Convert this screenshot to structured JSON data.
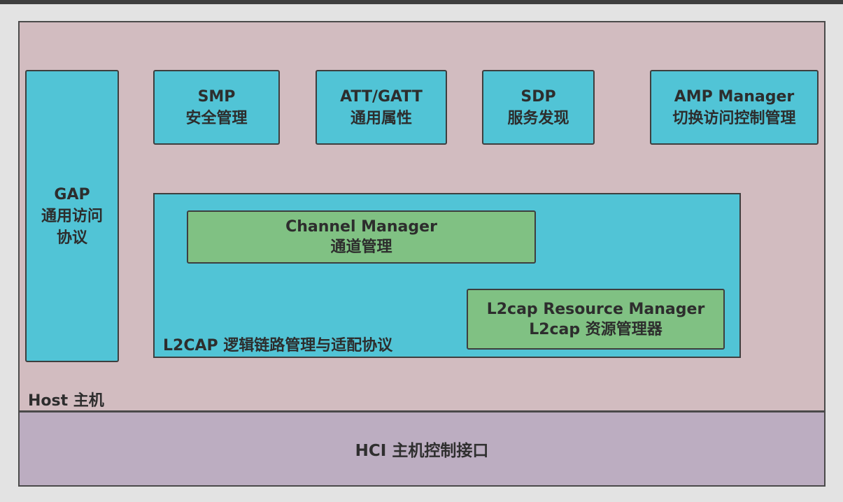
{
  "host": {
    "label": "Host 主机"
  },
  "hci": {
    "label": "HCI 主机控制接口"
  },
  "gap": {
    "line1": "GAP",
    "line2": "通用访问",
    "line3": "协议"
  },
  "smp": {
    "line1": "SMP",
    "line2": "安全管理"
  },
  "att": {
    "line1": "ATT/GATT",
    "line2": "通用属性"
  },
  "sdp": {
    "line1": "SDP",
    "line2": "服务发现"
  },
  "amp": {
    "line1": "AMP Manager",
    "line2": "切换访问控制管理"
  },
  "l2cap": {
    "label": "L2CAP 逻辑链路管理与适配协议",
    "channel": {
      "line1": "Channel Manager",
      "line2": "通道管理"
    },
    "resource": {
      "line1": "L2cap Resource Manager",
      "line2": "L2cap 资源管理器"
    }
  },
  "colors": {
    "host_bg": "#d2bcc0",
    "hci_bg": "#bcadc1",
    "module_bg": "#51c4d6",
    "submodule_bg": "#80c183",
    "border": "#3e3e3e"
  }
}
